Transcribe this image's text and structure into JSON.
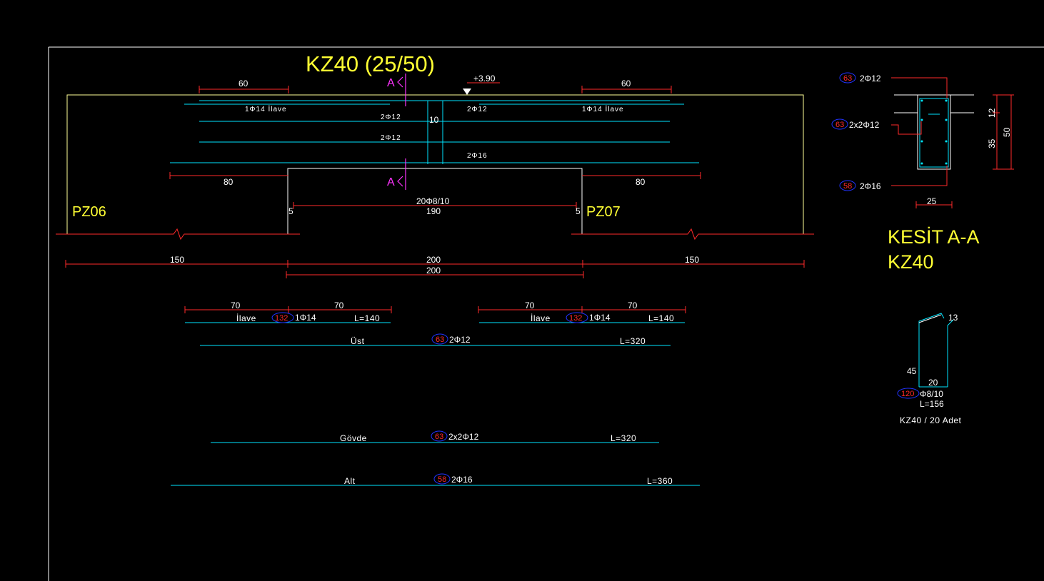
{
  "title": "KZ40 (25/50)",
  "elevation": "+3.90",
  "section_mark": "A",
  "supports": {
    "left": "PZ06",
    "right": "PZ07"
  },
  "dims": {
    "top_left_60": "60",
    "top_right_60": "60",
    "left_80": "80",
    "right_80": "80",
    "gap_10": "10",
    "stirrup_spec": "20Φ8/10",
    "clear_190": "190",
    "edge_left_5": "5",
    "edge_right_5": "5",
    "bottom_left_150": "150",
    "bottom_mid_200": "200",
    "bottom_right_150": "150",
    "bottom_mid_200_b": "200"
  },
  "beam_labels": {
    "ilave_left": "1Φ14 İlave",
    "ilave_right": "1Φ14 İlave",
    "top_2p12_left": "2Φ12",
    "top_2p12_right": "2Φ12",
    "mid_2p12": "2Φ12",
    "bottom_2p16": "2Φ16"
  },
  "bars": {
    "ilave_left": {
      "dim_a": "70",
      "dim_b": "70",
      "name": "İlave",
      "tag": "132",
      "spec": "1Φ14",
      "length": "L=140"
    },
    "ilave_right": {
      "dim_a": "70",
      "dim_b": "70",
      "name": "İlave",
      "tag": "132",
      "spec": "1Φ14",
      "length": "L=140"
    },
    "ust": {
      "name": "Üst",
      "tag": "63",
      "spec": "2Φ12",
      "length": "L=320"
    },
    "govde": {
      "name": "Gövde",
      "tag": "63",
      "spec": "2x2Φ12",
      "length": "L=320"
    },
    "alt": {
      "name": "Alt",
      "tag": "58",
      "spec": "2Φ16",
      "length": "L=360"
    }
  },
  "section": {
    "title": "KESİT A-A",
    "subtitle": "KZ40",
    "top": {
      "tag": "63",
      "spec": "2Φ12"
    },
    "mid": {
      "tag": "63",
      "spec": "2x2Φ12"
    },
    "bottom": {
      "tag": "58",
      "spec": "2Φ16"
    },
    "width": "25",
    "slab": "12",
    "depth": "35",
    "height": "50"
  },
  "stirrup": {
    "hook": "13",
    "height": "45",
    "width": "20",
    "tag": "120",
    "spec": "Φ8/10",
    "length": "L=156",
    "caption": "KZ40 / 20 Adet"
  },
  "colors": {
    "background": "#000000",
    "outline": "#ffffff",
    "rebar": "#00e5ff",
    "dimension": "#ff2a2a",
    "title": "#ffff33",
    "section_marker": "#ff33ff",
    "tag_ellipse": "#2233ff"
  }
}
